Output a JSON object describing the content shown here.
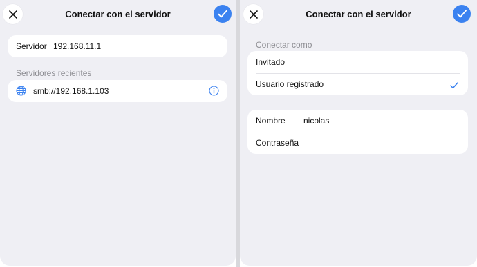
{
  "left": {
    "title": "Conectar con el servidor",
    "server_label": "Servidor",
    "server_value": "192.168.11.1",
    "recent_section": "Servidores recientes",
    "recent_items": [
      {
        "icon": "globe-icon",
        "address": "smb://192.168.1.103",
        "action_icon": "info-icon"
      }
    ]
  },
  "right": {
    "title": "Conectar con el servidor",
    "connect_as_section": "Conectar como",
    "options": [
      {
        "label": "Invitado",
        "selected": false
      },
      {
        "label": "Usuario registrado",
        "selected": true
      }
    ],
    "name_label": "Nombre",
    "name_value": "nicolas",
    "password_label": "Contraseña",
    "password_value": ""
  },
  "colors": {
    "accent": "#3b82f0",
    "background": "#efeff4",
    "card": "#ffffff",
    "secondary_text": "#8e8e93"
  }
}
